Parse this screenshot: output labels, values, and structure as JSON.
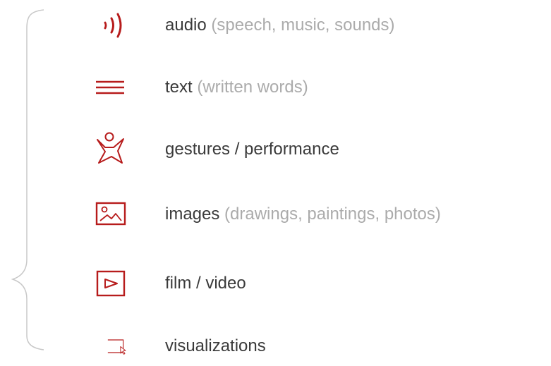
{
  "colors": {
    "accent": "#b71c1c",
    "main_text": "#3a3a3a",
    "note_text": "#ababab",
    "brace": "#c8c8c8"
  },
  "items": [
    {
      "icon": "audio-waves-icon",
      "label": "audio",
      "note": "(speech, music, sounds)"
    },
    {
      "icon": "text-lines-icon",
      "label": "text",
      "note": "(written words)"
    },
    {
      "icon": "person-gesture-icon",
      "label": "gestures / performance",
      "note": ""
    },
    {
      "icon": "image-landscape-icon",
      "label": "images",
      "note": "(drawings, paintings, photos)"
    },
    {
      "icon": "play-video-icon",
      "label": "film / video",
      "note": ""
    },
    {
      "icon": "screen-cursor-icon",
      "label": "visualizations",
      "note": ""
    }
  ]
}
